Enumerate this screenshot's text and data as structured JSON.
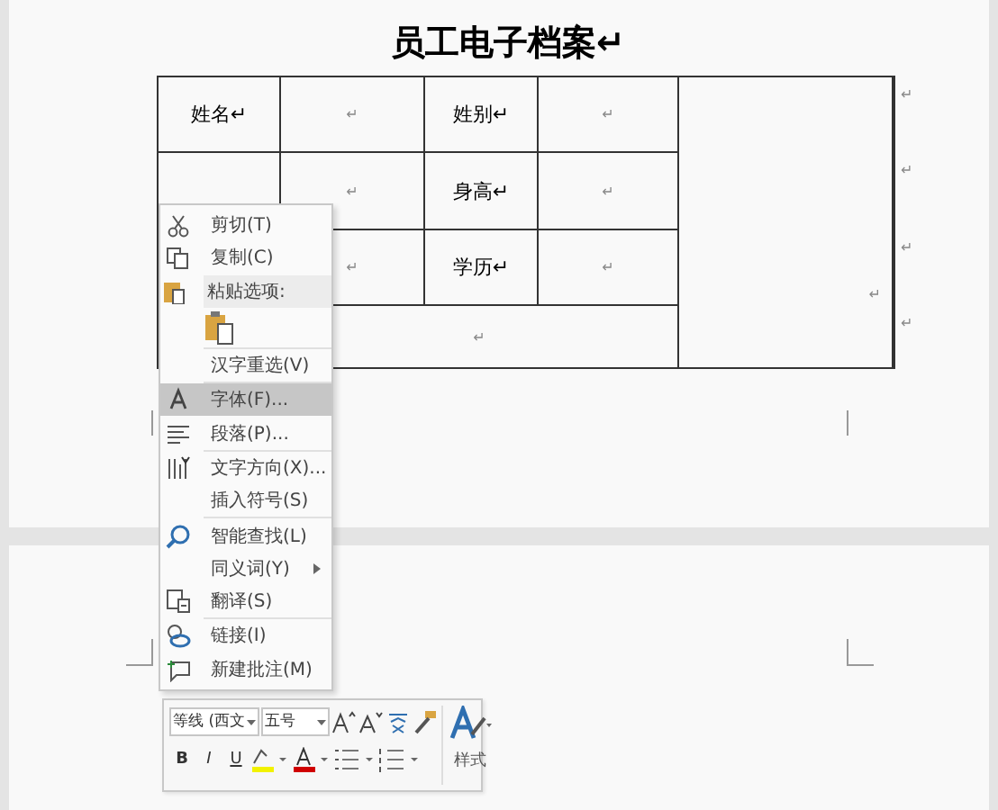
{
  "document": {
    "title": "员工电子档案↵",
    "table": {
      "cells": [
        "姓名↵",
        "↵",
        "姓别↵",
        "↵",
        "↵",
        "身高↵",
        "↵",
        "↵",
        "学历↵",
        "↵",
        "↵"
      ],
      "photo_cell": "↵",
      "row_end_marks": [
        "↵",
        "↵",
        "↵",
        "↵"
      ]
    }
  },
  "context_menu": {
    "items": [
      {
        "kind": "item",
        "label": "剪切(T)",
        "selected": false,
        "submenu": false
      },
      {
        "kind": "item",
        "label": "复制(C)",
        "selected": false,
        "submenu": false
      },
      {
        "kind": "header",
        "label": "粘贴选项:",
        "selected": false,
        "submenu": false
      },
      {
        "kind": "paste-option",
        "selected": false
      },
      {
        "kind": "separator"
      },
      {
        "kind": "item",
        "label": "汉字重选(V)",
        "selected": false,
        "submenu": false
      },
      {
        "kind": "separator"
      },
      {
        "kind": "item",
        "label": "字体(F)...",
        "selected": true,
        "submenu": false
      },
      {
        "kind": "item",
        "label": "段落(P)...",
        "selected": false,
        "submenu": false
      },
      {
        "kind": "separator"
      },
      {
        "kind": "item",
        "label": "文字方向(X)...",
        "selected": false,
        "submenu": false
      },
      {
        "kind": "item",
        "label": "插入符号(S)",
        "selected": false,
        "submenu": false
      },
      {
        "kind": "separator"
      },
      {
        "kind": "item",
        "label": "智能查找(L)",
        "selected": false,
        "submenu": false
      },
      {
        "kind": "item",
        "label": "同义词(Y)",
        "selected": false,
        "submenu": true
      },
      {
        "kind": "item",
        "label": "翻译(S)",
        "selected": false,
        "submenu": false
      },
      {
        "kind": "separator"
      },
      {
        "kind": "item",
        "label": "链接(I)",
        "selected": false,
        "submenu": false
      },
      {
        "kind": "item",
        "label": "新建批注(M)",
        "selected": false,
        "submenu": false
      }
    ]
  },
  "mini_toolbar": {
    "font_name": "等线 (西文",
    "font_size": "五号",
    "styles_label": "样式",
    "format_buttons": [
      "B",
      "I",
      "U"
    ]
  }
}
